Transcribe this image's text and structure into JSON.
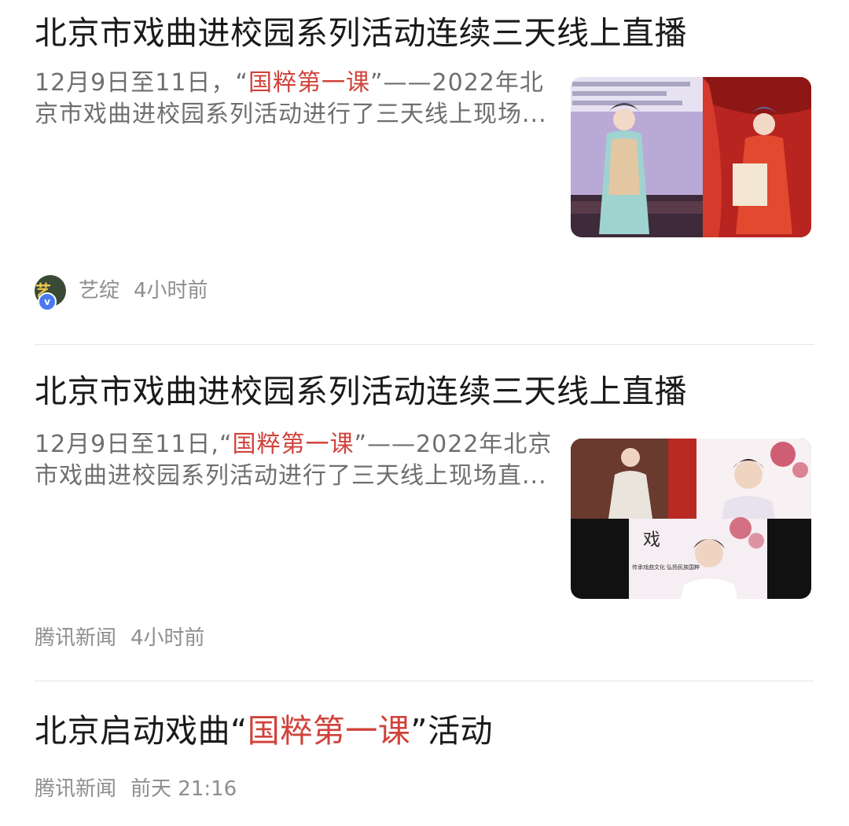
{
  "items": [
    {
      "title": "北京市戏曲进校园系列活动连续三天线上直播",
      "summary_before": "12月9日至11日，“",
      "summary_highlight": "国粹第一课",
      "summary_after": "”——2022年北京市戏曲进校园系列活动进行了三天线上现场...",
      "thumb_caption_lines": [
        "北京市东城区教育委员会",
        "北京市东城区少年宫",
        "北京市…传承促进会"
      ],
      "source": "艺绽",
      "avatar_text": "艺",
      "verified_badge": "v",
      "time": "4小时前"
    },
    {
      "title": "北京市戏曲进校园系列活动连续三天线上直播",
      "summary_before": "12月9日至11日,“",
      "summary_highlight": "国粹第一课",
      "summary_after": "”——2022年北京市戏曲进校园系列活动进行了三天线上现场直...",
      "thumb_caption_top": "戏",
      "thumb_caption_bottom": "传承戏曲文化 弘扬民族国粹",
      "source": "腾讯新闻",
      "time": "4小时前"
    },
    {
      "title_before": "北京启动戏曲“",
      "title_highlight": "国粹第一课",
      "title_after": "”活动",
      "source": "腾讯新闻",
      "time": "前天 21:16"
    }
  ],
  "colors": {
    "highlight": "#d0433b",
    "title": "#1a1a1a",
    "summary": "#6f6f6f",
    "meta": "#8e8e8e",
    "divider": "#e6e6e6"
  }
}
